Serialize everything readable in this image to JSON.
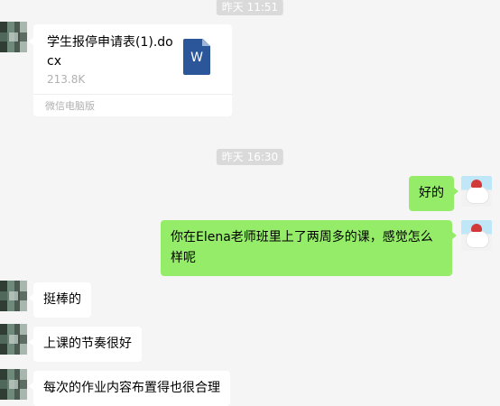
{
  "timestamps": [
    "昨天 11:51",
    "昨天 16:30"
  ],
  "file_message": {
    "name": "学生报停申请表(1).docx",
    "size": "213.8K",
    "source": "微信电脑版",
    "icon": "word-doc-icon",
    "icon_letter": "W"
  },
  "messages": [
    {
      "side": "right",
      "text": "好的"
    },
    {
      "side": "right",
      "text": "你在Elena老师班里上了两周多的课，感觉怎么样呢"
    },
    {
      "side": "left",
      "text": "挺棒的"
    },
    {
      "side": "left",
      "text": "上课的节奏很好"
    },
    {
      "side": "left",
      "text": "每次的作业内容布置得也很合理"
    }
  ],
  "colors": {
    "background": "#f5f5f5",
    "own_bubble": "#95ec69",
    "other_bubble": "#ffffff",
    "timestamp_bg": "#dadada",
    "word_blue": "#2b579a"
  }
}
